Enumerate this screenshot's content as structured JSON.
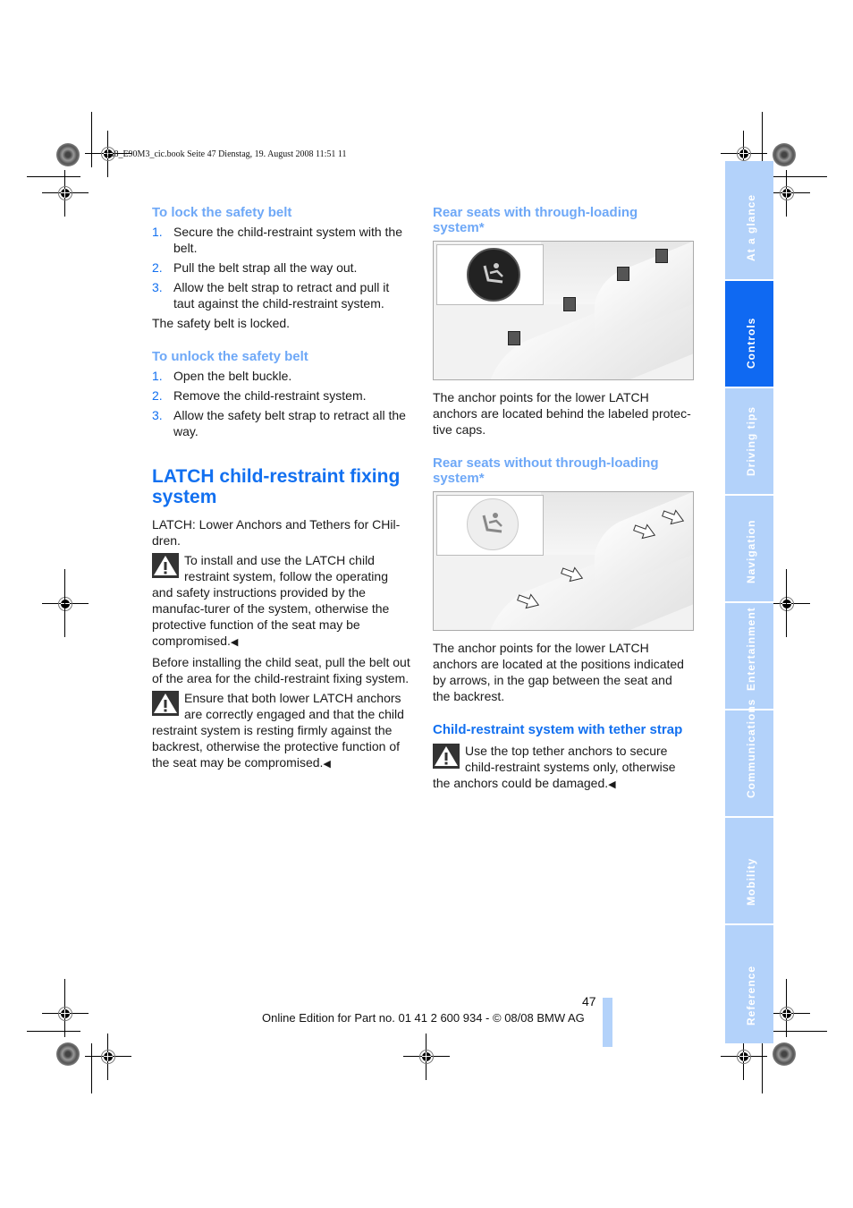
{
  "slug": "ba8_E90M3_cic.book  Seite 47  Dienstag, 19. August 2008  11:51 11",
  "left": {
    "lock": {
      "heading": "To lock the safety belt",
      "steps": [
        {
          "num": "1.",
          "text": "Secure the child-restraint system with the belt."
        },
        {
          "num": "2.",
          "text": "Pull the belt strap all the way out."
        },
        {
          "num": "3.",
          "text": "Allow the belt strap to retract and pull it taut against the child-restraint system."
        }
      ],
      "result": "The safety belt is locked."
    },
    "unlock": {
      "heading": "To unlock the safety belt",
      "steps": [
        {
          "num": "1.",
          "text": "Open the belt buckle."
        },
        {
          "num": "2.",
          "text": "Remove the child-restraint system."
        },
        {
          "num": "3.",
          "text": "Allow the safety belt strap to retract all the way."
        }
      ]
    },
    "latch": {
      "heading": "LATCH child-restraint fixing system",
      "intro": "LATCH: Lower Anchors and Tethers for CHil-dren.",
      "warning1": "To install and use the LATCH child restraint system, follow the operating and safety instructions provided by the manufac-turer of the system, otherwise the protective function of the seat may be compromised.",
      "before": "Before installing the child seat, pull the belt out of the area for the child-restraint fixing system.",
      "warning2": "Ensure that both lower LATCH anchors are correctly engaged and that the child restraint system is resting firmly against the backrest, otherwise the protective function of the seat may be compromised."
    }
  },
  "right": {
    "through": {
      "heading": "Rear seats with through-loading system*",
      "caption": "The anchor points for the lower LATCH anchors are located behind the labeled protec-tive caps."
    },
    "without": {
      "heading": "Rear seats without through-loading system*",
      "caption": "The anchor points for the lower LATCH anchors are located at the positions indicated by arrows, in the gap between the seat and the backrest."
    },
    "tether": {
      "heading": "Child-restraint system with tether strap",
      "warning": "Use the top tether anchors to secure child-restraint systems only, otherwise the anchors could be damaged."
    }
  },
  "end_mark": "◀",
  "tabs": [
    {
      "label": "At a glance",
      "active": false
    },
    {
      "label": "Controls",
      "active": true
    },
    {
      "label": "Driving tips",
      "active": false
    },
    {
      "label": "Navigation",
      "active": false
    },
    {
      "label": "Entertainment",
      "active": false
    },
    {
      "label": "Communications",
      "active": false
    },
    {
      "label": "Mobility",
      "active": false
    },
    {
      "label": "Reference",
      "active": false
    }
  ],
  "footer": {
    "page_number": "47",
    "edition": "Online Edition for Part no. 01 41 2 600 934 - © 08/08 BMW AG"
  },
  "colors": {
    "accent": "#1270f0",
    "subhead": "#6ea8f7",
    "tab_inactive": "#b3d2fa",
    "tab_active": "#0f69f2"
  }
}
